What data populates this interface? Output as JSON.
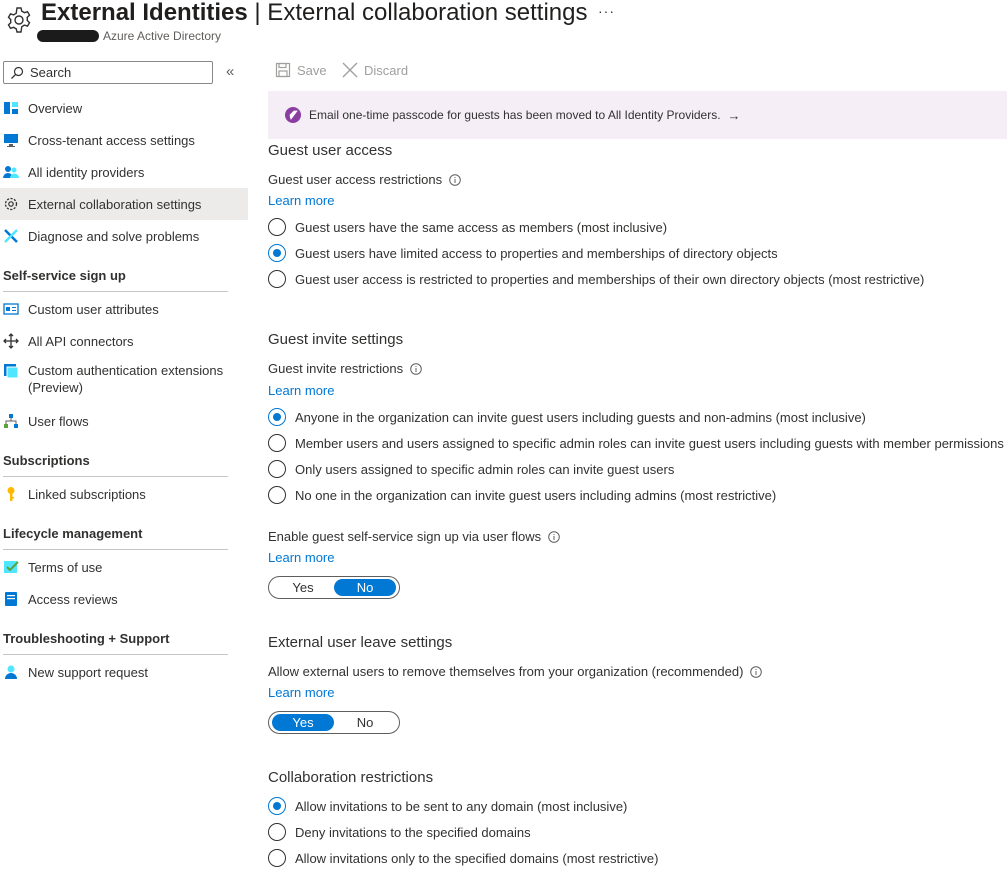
{
  "header": {
    "title_bold": "External Identities",
    "title_rest": " | External collaboration settings",
    "subtitle": "Azure Active Directory",
    "more": "···"
  },
  "sidebar": {
    "search_placeholder": "Search",
    "collapse": "«",
    "items": [
      {
        "label": "Overview",
        "icon": "overview-icon"
      },
      {
        "label": "Cross-tenant access settings",
        "icon": "monitor-icon"
      },
      {
        "label": "All identity providers",
        "icon": "users-icon"
      },
      {
        "label": "External collaboration settings",
        "icon": "gear-icon"
      },
      {
        "label": "Diagnose and solve problems",
        "icon": "wrench-icon"
      }
    ],
    "sections": [
      {
        "title": "Self-service sign up",
        "items": [
          {
            "label": "Custom user attributes",
            "icon": "attributes-icon"
          },
          {
            "label": "All API connectors",
            "icon": "connector-icon"
          },
          {
            "label": "Custom authentication extensions\n(Preview)",
            "icon": "extension-icon"
          },
          {
            "label": "User flows",
            "icon": "flow-icon"
          }
        ]
      },
      {
        "title": "Subscriptions",
        "items": [
          {
            "label": "Linked subscriptions",
            "icon": "key-icon"
          }
        ]
      },
      {
        "title": "Lifecycle management",
        "items": [
          {
            "label": "Terms of use",
            "icon": "terms-icon"
          },
          {
            "label": "Access reviews",
            "icon": "reviews-icon"
          }
        ]
      },
      {
        "title": "Troubleshooting + Support",
        "items": [
          {
            "label": "New support request",
            "icon": "support-icon"
          }
        ]
      }
    ]
  },
  "toolbar": {
    "save_label": "Save",
    "discard_label": "Discard"
  },
  "banner": {
    "text": "Email one-time passcode for guests has been moved to All Identity Providers.",
    "arrow": "→"
  },
  "guest_access": {
    "heading": "Guest user access",
    "label": "Guest user access restrictions",
    "learn_more": "Learn more",
    "options": [
      "Guest users have the same access as members (most inclusive)",
      "Guest users have limited access to properties and memberships of directory objects",
      "Guest user access is restricted to properties and memberships of their own directory objects (most restrictive)"
    ],
    "selected": 1
  },
  "guest_invite": {
    "heading": "Guest invite settings",
    "label": "Guest invite restrictions",
    "learn_more": "Learn more",
    "options": [
      "Anyone in the organization can invite guest users including guests and non-admins (most inclusive)",
      "Member users and users assigned to specific admin roles can invite guest users including guests with member permissions",
      "Only users assigned to specific admin roles can invite guest users",
      "No one in the organization can invite guest users including admins (most restrictive)"
    ],
    "selected": 0
  },
  "self_service": {
    "label": "Enable guest self-service sign up via user flows",
    "learn_more": "Learn more",
    "yes": "Yes",
    "no": "No",
    "value": "No"
  },
  "leave": {
    "heading": "External user leave settings",
    "label": "Allow external users to remove themselves from your organization (recommended)",
    "learn_more": "Learn more",
    "yes": "Yes",
    "no": "No",
    "value": "Yes"
  },
  "collab": {
    "heading": "Collaboration restrictions",
    "options": [
      "Allow invitations to be sent to any domain (most inclusive)",
      "Deny invitations to the specified domains",
      "Allow invitations only to the specified domains (most restrictive)"
    ],
    "selected": 0
  },
  "colors": {
    "accent": "#0078d4",
    "banner_bg": "#f6eef7",
    "banner_icon": "#8a3ea1",
    "active_nav": "#edebe9"
  }
}
